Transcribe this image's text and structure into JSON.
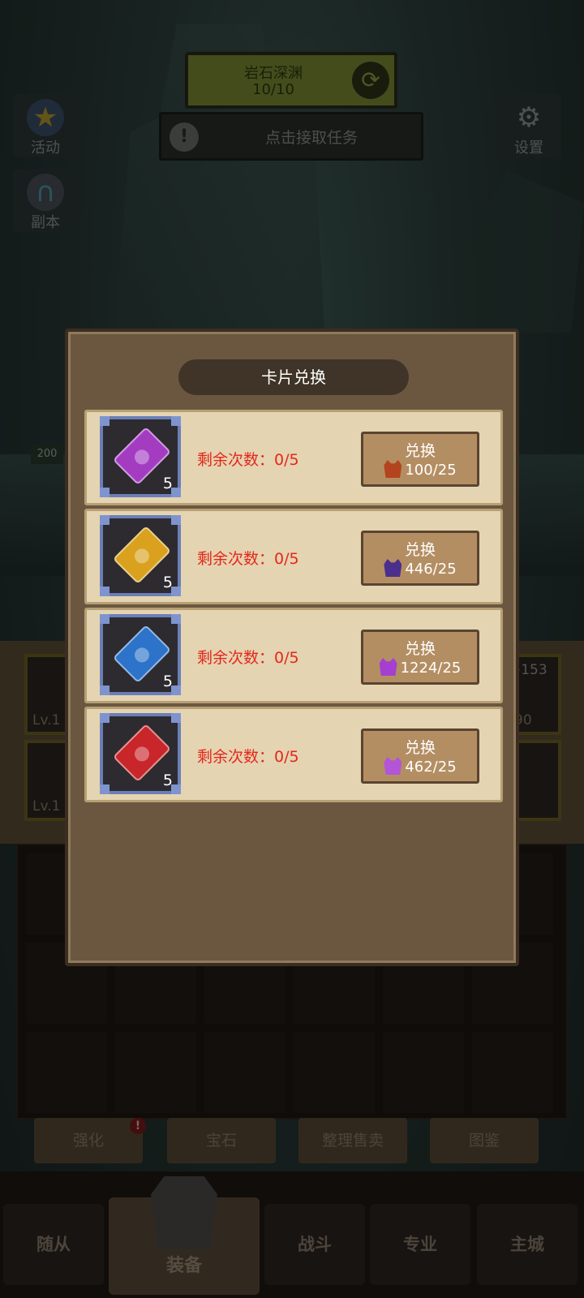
{
  "hud": {
    "dungeon_name": "岩石深渊",
    "dungeon_progress": "10/10",
    "quest_prompt": "点击接取任务",
    "activity_label": "活动",
    "instance_label": "副本",
    "settings_label": "设置"
  },
  "inventory": {
    "slot_levels": [
      "Lv.1",
      "Lv.1"
    ],
    "right_slot_bonus": "+153",
    "right_slot_value": "90",
    "left_value": "200"
  },
  "actions": {
    "enhance": "强化",
    "gem": "宝石",
    "sort_sell": "整理售卖",
    "codex": "图鉴",
    "badge": "!"
  },
  "tabs": {
    "follower": "随从",
    "equipment": "装备",
    "battle": "战斗",
    "profession": "专业",
    "main_city": "主城"
  },
  "modal": {
    "title": "卡片兑换",
    "rows": [
      {
        "card_color": "#a43cc2",
        "count": "5",
        "remaining": "剩余次数：0/5",
        "button": "兑换",
        "cost": "100/25",
        "material_color": "#b4441e"
      },
      {
        "card_color": "#d9a11e",
        "count": "5",
        "remaining": "剩余次数：0/5",
        "button": "兑换",
        "cost": "446/25",
        "material_color": "#4a2f8c"
      },
      {
        "card_color": "#2c73c9",
        "count": "5",
        "remaining": "剩余次数：0/5",
        "button": "兑换",
        "cost": "1224/25",
        "material_color": "#a53fd0"
      },
      {
        "card_color": "#c8262a",
        "count": "5",
        "remaining": "剩余次数：0/5",
        "button": "兑换",
        "cost": "462/25",
        "material_color": "#b255d8"
      }
    ]
  }
}
